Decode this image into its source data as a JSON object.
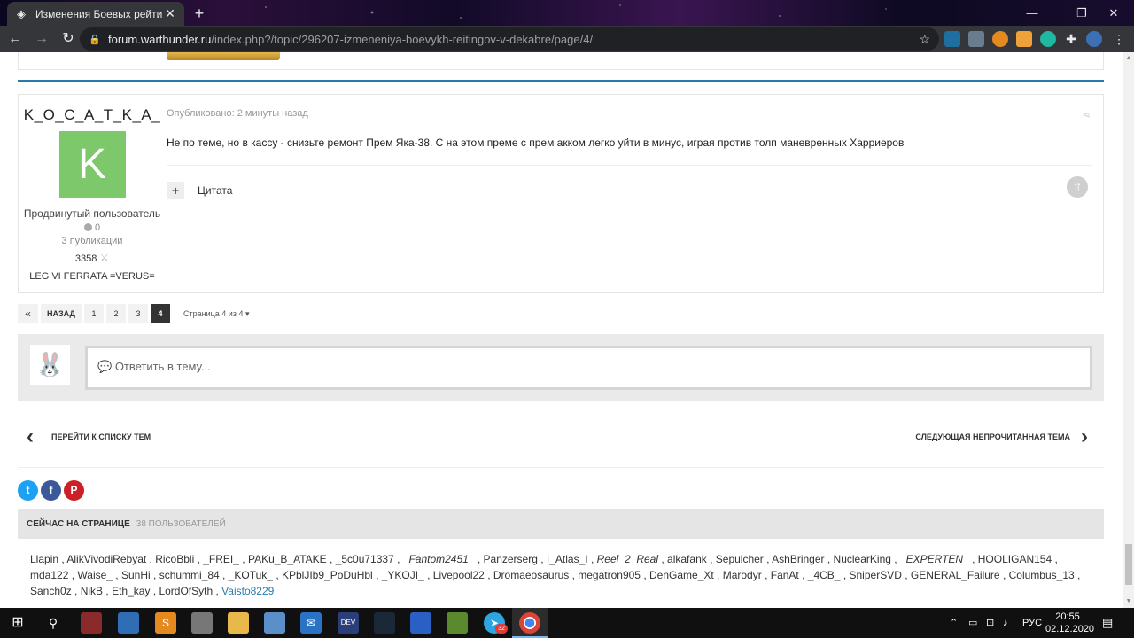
{
  "browser": {
    "tab_title": "Изменения Боевых рейтингов",
    "tab_close": "✕",
    "new_tab": "+",
    "url_host": "forum.warthunder.ru",
    "url_path": "/index.php?/topic/296207-izmeneniya-boevykh-reitingov-v-dekabre/page/4/"
  },
  "post": {
    "author_name": "K_O_C_A_T_K_A_",
    "avatar_letter": "K",
    "rank": "Продвинутый пользователь",
    "reputation": "0",
    "posts_count": "3 публикации",
    "points": "3358",
    "clan": "LEG VI FERRATA =VERUS=",
    "posted": "Опубликовано: 2 минуты назад",
    "body": "Не по теме, но в кассу - снизьте ремонт Прем Яка-38. С на этом преме с прем акком легко уйти в минус, играя против толп маневренных Харриеров",
    "quote_label": "Цитата",
    "multiquote": "+"
  },
  "pagination": {
    "first": "«",
    "prev": "НАЗАД",
    "pages": [
      "1",
      "2",
      "3",
      "4"
    ],
    "active": "4",
    "jump": "Страница 4 из 4"
  },
  "reply": {
    "placeholder": "Ответить в тему..."
  },
  "topic_nav": {
    "back": "ПЕРЕЙТИ К СПИСКУ ТЕМ",
    "next": "СЛЕДУЮЩАЯ НЕПРОЧИТАННАЯ ТЕМА"
  },
  "social": {
    "twitter_color": "#1da1f2",
    "facebook_color": "#3b5998",
    "pinterest_color": "#cb2027"
  },
  "online": {
    "title": "СЕЙЧАС НА СТРАНИЦЕ",
    "count": "38 ПОЛЬЗОВАТЕЛЕЙ",
    "users": [
      {
        "name": "Llapin",
        "style": ""
      },
      {
        "name": "AlikVivodiRebyat",
        "style": ""
      },
      {
        "name": "RicoBbli",
        "style": ""
      },
      {
        "name": "_FREI_",
        "style": ""
      },
      {
        "name": "PAKu_B_ATAKE",
        "style": ""
      },
      {
        "name": "_5c0u71337",
        "style": ""
      },
      {
        "name": "_Fantom2451_",
        "style": "it"
      },
      {
        "name": "Panzerserg",
        "style": ""
      },
      {
        "name": "I_Atlas_I",
        "style": ""
      },
      {
        "name": "Reel_2_Real",
        "style": "it"
      },
      {
        "name": "alkafank",
        "style": ""
      },
      {
        "name": "Sepulcher",
        "style": ""
      },
      {
        "name": "AshBringer",
        "style": ""
      },
      {
        "name": "NuclearKing",
        "style": ""
      },
      {
        "name": "_EXPERTEN_",
        "style": "it"
      },
      {
        "name": "HOOLIGAN154",
        "style": ""
      },
      {
        "name": "mda122",
        "style": ""
      },
      {
        "name": "Waise_",
        "style": ""
      },
      {
        "name": "SunHi",
        "style": ""
      },
      {
        "name": "schummi_84",
        "style": ""
      },
      {
        "name": "_KOTuk_",
        "style": ""
      },
      {
        "name": "KPblJIb9_PoDuHbl",
        "style": ""
      },
      {
        "name": "_YKOJI_",
        "style": ""
      },
      {
        "name": "Livepool22",
        "style": ""
      },
      {
        "name": "Dromaeosaurus",
        "style": ""
      },
      {
        "name": "megatron905",
        "style": ""
      },
      {
        "name": "DenGame_Xt",
        "style": ""
      },
      {
        "name": "Marodyr",
        "style": ""
      },
      {
        "name": "FanAt",
        "style": ""
      },
      {
        "name": "_4CB_",
        "style": ""
      },
      {
        "name": "SniperSVD",
        "style": ""
      },
      {
        "name": "GENERAL_Failure",
        "style": ""
      },
      {
        "name": "Columbus_13",
        "style": ""
      },
      {
        "name": "Sanch0z",
        "style": ""
      },
      {
        "name": "NikB",
        "style": ""
      },
      {
        "name": "Eth_kay",
        "style": ""
      },
      {
        "name": "LordOfSyth",
        "style": ""
      },
      {
        "name": "Vaisto8229",
        "style": "link"
      }
    ]
  },
  "taskbar": {
    "lang": "РУС",
    "time": "20:55",
    "date": "02.12.2020",
    "telegram_badge": "32"
  }
}
